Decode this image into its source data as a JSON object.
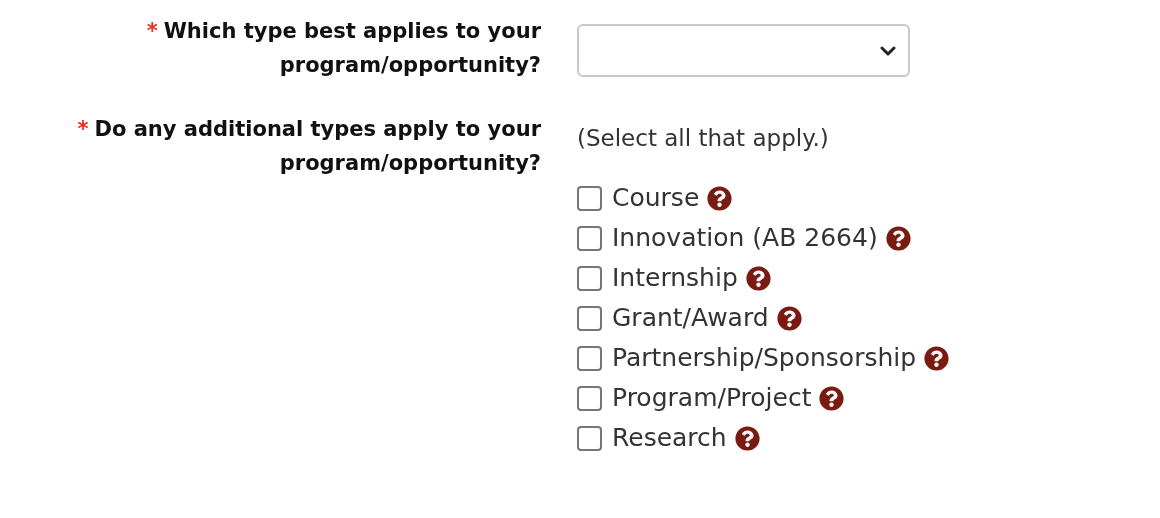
{
  "questions": [
    {
      "marker": "*",
      "label": "Which type best applies to your program/opportunity?",
      "kind": "select"
    },
    {
      "marker": "*",
      "label": "Do any additional types apply to your program/opportunity?",
      "kind": "checkboxes",
      "hint": "(Select all that apply.)",
      "options": [
        {
          "label": "Course",
          "checked": false
        },
        {
          "label": "Innovation (AB 2664)",
          "checked": false
        },
        {
          "label": "Internship",
          "checked": false
        },
        {
          "label": "Grant/Award",
          "checked": false
        },
        {
          "label": "Partnership/Sponsorship",
          "checked": false
        },
        {
          "label": "Program/Project",
          "checked": false
        },
        {
          "label": "Research",
          "checked": false
        }
      ]
    }
  ]
}
